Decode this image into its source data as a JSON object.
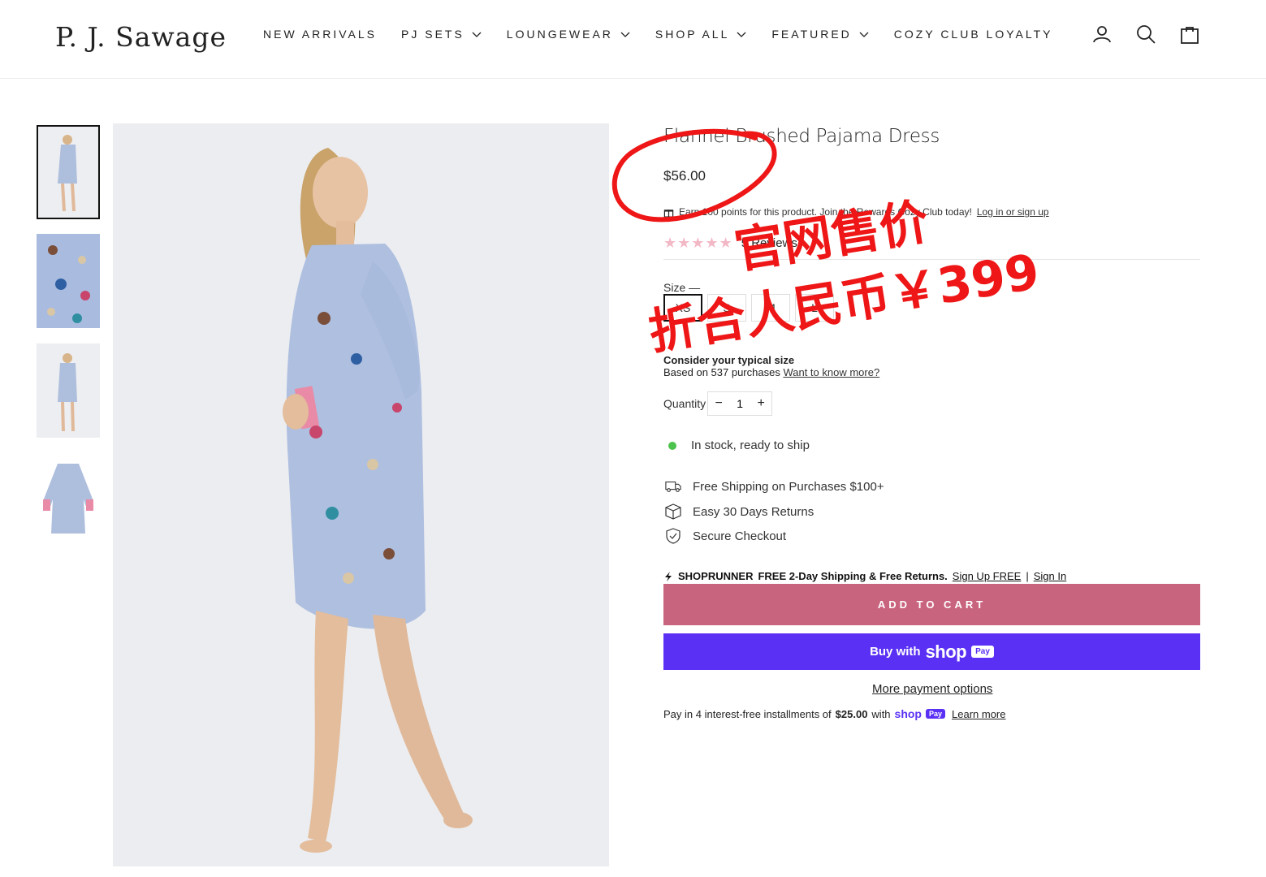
{
  "brand": {
    "logo": "P. J. Sawage"
  },
  "nav": [
    {
      "label": "NEW ARRIVALS",
      "has_dropdown": false
    },
    {
      "label": "PJ SETS",
      "has_dropdown": true
    },
    {
      "label": "LOUNGEWEAR",
      "has_dropdown": true
    },
    {
      "label": "SHOP ALL",
      "has_dropdown": true
    },
    {
      "label": "FEATURED",
      "has_dropdown": true
    },
    {
      "label": "COZY CLUB LOYALTY",
      "has_dropdown": false
    }
  ],
  "header_icons": [
    "account-icon",
    "search-icon",
    "cart-icon"
  ],
  "product": {
    "title": "Flannel Brushed Pajama Dress",
    "price": "$56.00",
    "rewards_text": "Earn 100 points for this product. Join the Rewards Cozy Club today!",
    "rewards_link": "Log in or sign up",
    "rating": 4.5,
    "stars": "★★★★★",
    "reviews_label": "5 Reviews",
    "size_label": "Size —",
    "sizes": [
      "XS",
      "S",
      "M",
      "L"
    ],
    "selected_size": "XS",
    "fit_title": "Consider your typical size",
    "fit_based": "Based on 537 purchases",
    "fit_link": "Want to know more?",
    "quantity_label": "Quantity",
    "quantity": "1",
    "qty_minus": "−",
    "qty_plus": "+",
    "stock": "In stock, ready to ship",
    "features": [
      {
        "icon": "truck-icon",
        "text": "Free Shipping on Purchases $100+"
      },
      {
        "icon": "box-icon",
        "text": "Easy 30 Days Returns"
      },
      {
        "icon": "shield-check-icon",
        "text": "Secure Checkout"
      }
    ],
    "shoprunner": {
      "brand": "SHOPRUNNER",
      "offer": "FREE 2-Day Shipping & Free Returns.",
      "signup": "Sign Up FREE",
      "sep": "|",
      "signin": "Sign In"
    },
    "add_to_cart": "ADD TO CART",
    "shop_pay": {
      "buy": "Buy with",
      "shop": "shop",
      "pay": "Pay"
    },
    "more_payment": "More payment options",
    "installments": {
      "prefix": "Pay in 4 interest-free installments of",
      "amount": "$25.00",
      "with": "with",
      "shop": "shop",
      "pay": "Pay",
      "learn": "Learn more"
    }
  },
  "annotation": {
    "line1": "官网售价",
    "line2": "折合人民币￥399",
    "color": "#ee1616"
  },
  "colors": {
    "accent_button": "#c9647f",
    "shop_pay": "#5a31f4",
    "in_stock": "#4cc34c",
    "star": "#f3b8c6"
  }
}
